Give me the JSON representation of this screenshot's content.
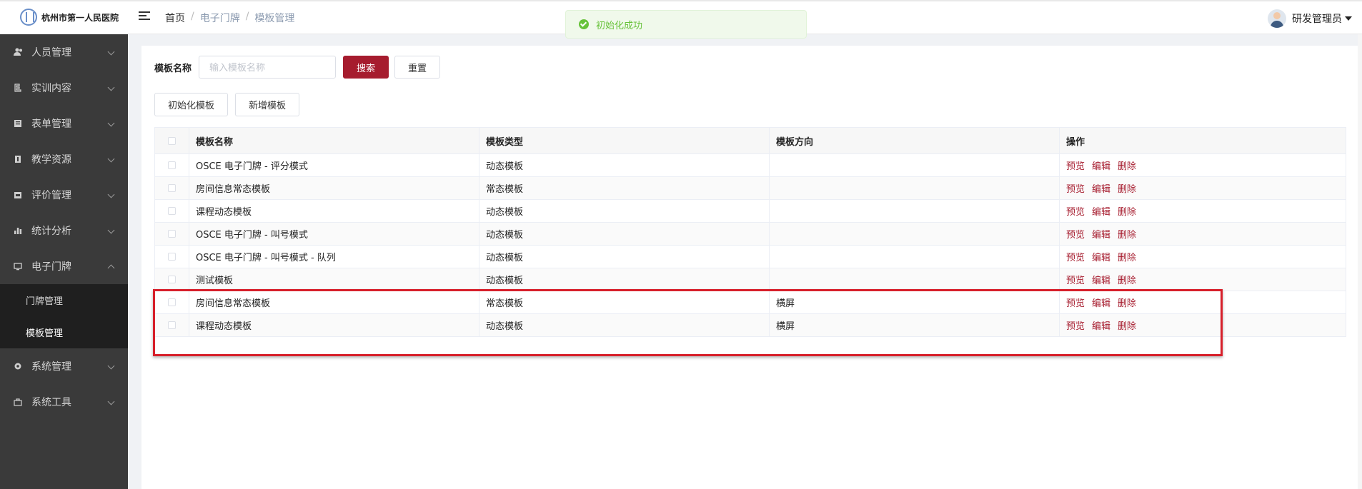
{
  "header": {
    "logo_text": "杭州市第一人民医院",
    "breadcrumb": [
      "首页",
      "电子门牌",
      "模板管理"
    ],
    "toast": "初始化成功",
    "user_name": "研发管理员"
  },
  "sidebar": {
    "items": [
      {
        "label": "人员管理",
        "icon": "people-icon"
      },
      {
        "label": "实训内容",
        "icon": "training-icon"
      },
      {
        "label": "表单管理",
        "icon": "form-icon"
      },
      {
        "label": "教学资源",
        "icon": "book-icon"
      },
      {
        "label": "评价管理",
        "icon": "evaluation-icon"
      },
      {
        "label": "统计分析",
        "icon": "bar-chart-icon"
      },
      {
        "label": "电子门牌",
        "icon": "monitor-icon"
      }
    ],
    "sub_items": [
      "门牌管理",
      "模板管理"
    ],
    "bottom_items": [
      {
        "label": "系统管理",
        "icon": "gear-icon"
      },
      {
        "label": "系统工具",
        "icon": "toolbox-icon"
      }
    ]
  },
  "search": {
    "label": "模板名称",
    "placeholder": "输入模板名称",
    "search_button": "搜索",
    "reset_button": "重置"
  },
  "toolbar": {
    "init_button": "初始化模板",
    "add_button": "新增模板"
  },
  "table": {
    "headers": [
      "模板名称",
      "模板类型",
      "模板方向",
      "操作"
    ],
    "actions": [
      "预览",
      "编辑",
      "删除"
    ],
    "rows": [
      {
        "name": "OSCE 电子门牌 - 评分模式",
        "type": "动态模板",
        "direction": ""
      },
      {
        "name": "房间信息常态模板",
        "type": "常态模板",
        "direction": ""
      },
      {
        "name": "课程动态模板",
        "type": "动态模板",
        "direction": ""
      },
      {
        "name": "OSCE 电子门牌 - 叫号模式",
        "type": "动态模板",
        "direction": ""
      },
      {
        "name": "OSCE 电子门牌 - 叫号模式 - 队列",
        "type": "动态模板",
        "direction": ""
      },
      {
        "name": "测试模板",
        "type": "动态模板",
        "direction": ""
      },
      {
        "name": "房间信息常态模板",
        "type": "常态模板",
        "direction": "横屏"
      },
      {
        "name": "课程动态模板",
        "type": "动态模板",
        "direction": "横屏"
      }
    ]
  },
  "colors": {
    "accent": "#a61c2e",
    "sidebar_bg": "#3a3a3a",
    "highlight_box": "#d71f2a",
    "toast_green": "#67c23a"
  }
}
